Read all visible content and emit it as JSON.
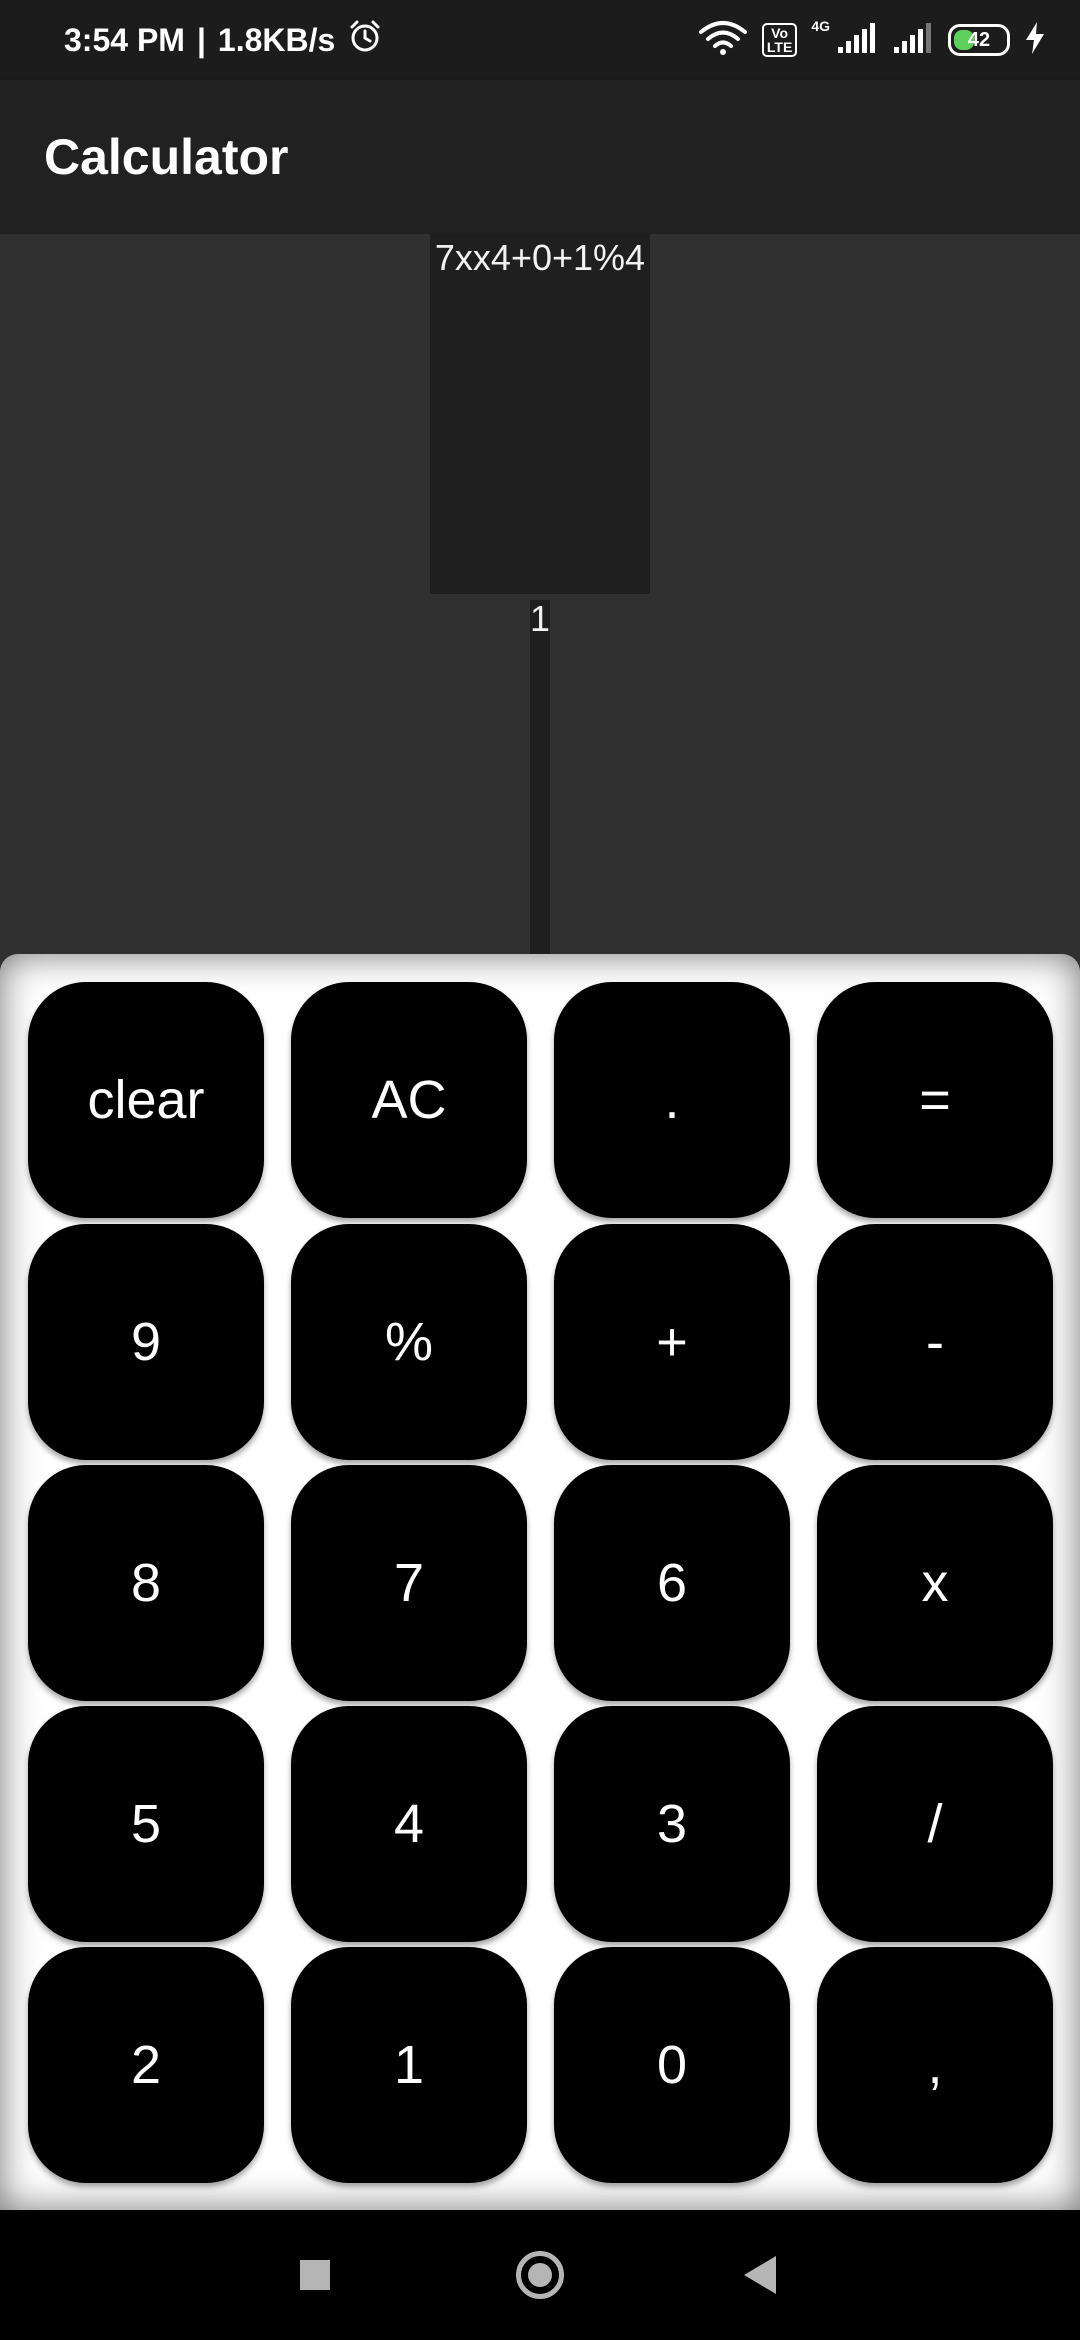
{
  "status_bar": {
    "time": "3:54 PM",
    "separator": "|",
    "network_speed": "1.8KB/s",
    "network_type": "4G",
    "volte_line1": "Vo",
    "volte_line2": "LTE",
    "battery_level": "42"
  },
  "app_bar": {
    "title": "Calculator"
  },
  "display": {
    "expression": "7xx4+0+1%4",
    "result": "1"
  },
  "keypad": {
    "rows": [
      [
        "clear",
        "AC",
        ".",
        "="
      ],
      [
        "9",
        "%",
        "+",
        "-"
      ],
      [
        "8",
        "7",
        "6",
        "x"
      ],
      [
        "5",
        "4",
        "3",
        "/"
      ],
      [
        "2",
        "1",
        "0",
        ","
      ]
    ]
  },
  "nav_bar": {
    "recents_icon": "square-icon",
    "home_icon": "circle-icon",
    "back_icon": "triangle-back-icon"
  },
  "colors": {
    "status_bar_bg": "#1c1c1c",
    "app_bar_bg": "#212121",
    "display_bg": "#303030",
    "key_bg": "#000000",
    "keypad_bg": "#ffffff",
    "battery_fill": "#5bd05b"
  }
}
